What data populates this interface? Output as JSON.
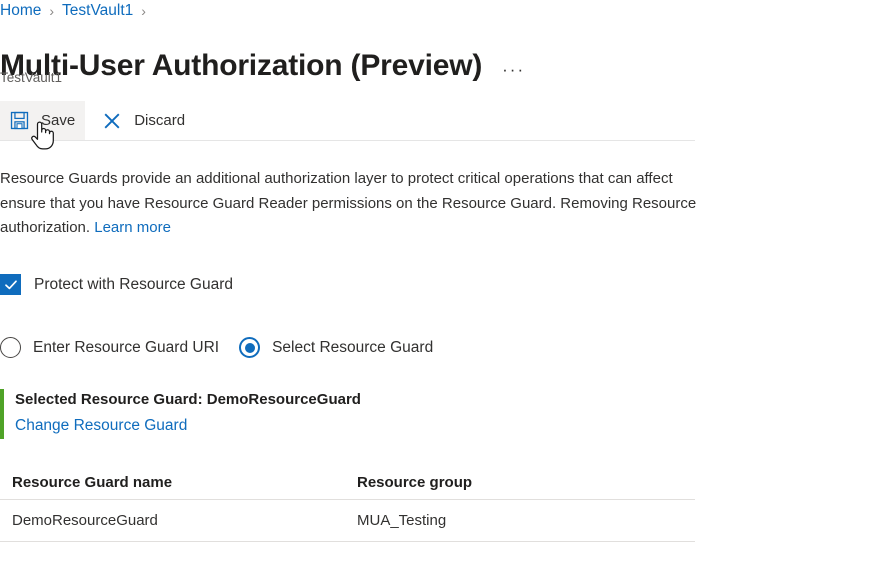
{
  "breadcrumb": {
    "items": [
      {
        "label": "Home"
      },
      {
        "label": "TestVault1"
      }
    ],
    "separator": "›"
  },
  "header": {
    "title": "Multi-User Authorization (Preview)",
    "more_options": "···",
    "subtitle": "TestVault1"
  },
  "toolbar": {
    "save_label": "Save",
    "save_icon": "save-floppy-icon",
    "discard_label": "Discard",
    "discard_icon": "close-x-icon",
    "accent_color": "#0f6cbd",
    "hover_color": "#f3f2f1"
  },
  "description": {
    "line1": "Resource Guards provide an additional authorization layer to protect critical operations that can affect",
    "line2": "ensure that you have Resource Guard Reader permissions on the Resource Guard. Removing Resource",
    "line3_text": "authorization.",
    "line3_link": "Learn more"
  },
  "protect_checkbox": {
    "label": "Protect with Resource Guard",
    "checked": true,
    "check_glyph": "✓",
    "color": "#0f6cbd"
  },
  "guard_mode": {
    "options": [
      {
        "label": "Enter Resource Guard URI",
        "selected": false
      },
      {
        "label": "Select Resource Guard",
        "selected": true
      }
    ],
    "selected_index": 1,
    "accent_color": "#0f6cbd"
  },
  "selected_guard": {
    "title": "Selected Resource Guard: DemoResourceGuard",
    "change_link": "Change Resource Guard",
    "accent_color": "#4fa327"
  },
  "table": {
    "columns": [
      "Resource Guard name",
      "Resource group"
    ],
    "rows": [
      [
        "DemoResourceGuard",
        "MUA_Testing"
      ]
    ]
  }
}
